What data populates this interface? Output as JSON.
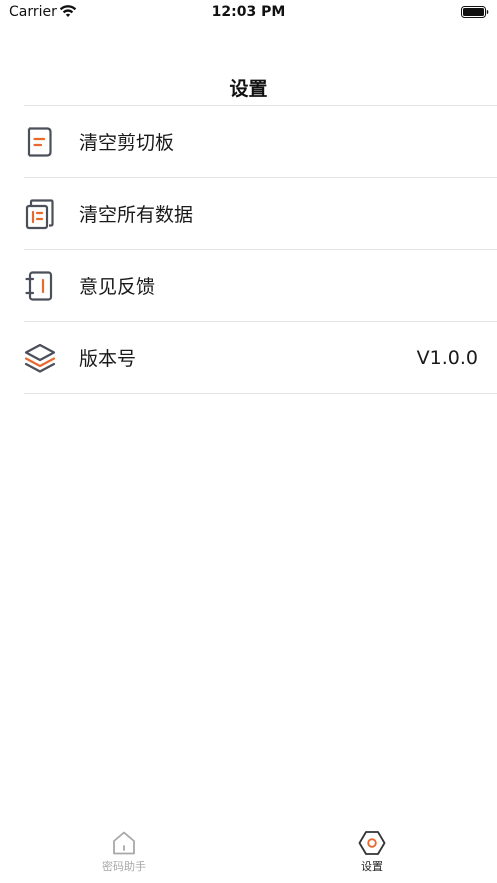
{
  "status_bar": {
    "carrier": "Carrier",
    "time": "12:03 PM"
  },
  "nav": {
    "title": "设置"
  },
  "settings": {
    "items": [
      {
        "label": "清空剪切板",
        "icon": "clipboard-icon",
        "value": ""
      },
      {
        "label": "清空所有数据",
        "icon": "documents-icon",
        "value": ""
      },
      {
        "label": "意见反馈",
        "icon": "notebook-icon",
        "value": ""
      },
      {
        "label": "版本号",
        "icon": "layers-icon",
        "value": "V1.0.0"
      }
    ]
  },
  "tab_bar": {
    "tabs": [
      {
        "label": "密码助手",
        "icon": "home-icon",
        "active": false
      },
      {
        "label": "设置",
        "icon": "hexagon-settings-icon",
        "active": true
      }
    ]
  },
  "colors": {
    "accent": "#e8692e",
    "icon_gray": "#4a4f5a",
    "divider": "#e3e3e3",
    "inactive_tab": "#a8a8a8"
  }
}
